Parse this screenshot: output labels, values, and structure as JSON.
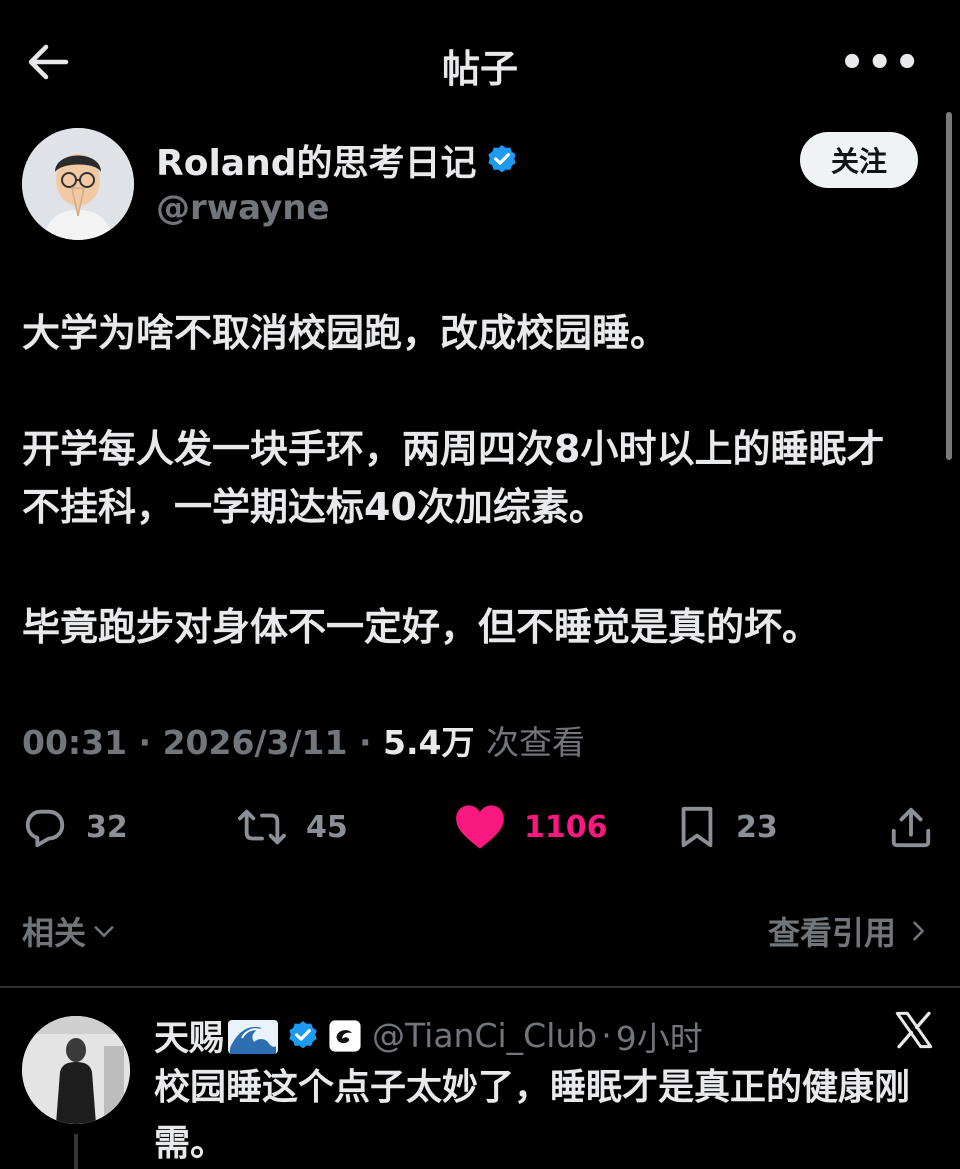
{
  "header": {
    "title": "帖子",
    "more_label": "•••"
  },
  "post": {
    "author": {
      "display_name": "Roland的思考日记",
      "handle": "@rwayne",
      "verified": true
    },
    "follow_label": "关注",
    "paragraphs": [
      "大学为啥不取消校园跑，改成校园睡。",
      "开学每人发一块手环，两周四次8小时以上的睡眠才不挂科，一学期达标40次加综素。",
      "毕竟跑步对身体不一定好，但不睡觉是真的坏。"
    ],
    "meta": {
      "time": "00:31",
      "date": "2026/3/11",
      "views": "5.4万",
      "views_label": "次查看",
      "separator": "·"
    },
    "actions": {
      "replies": "32",
      "retweets": "45",
      "likes": "1106",
      "bookmarks": "23"
    }
  },
  "related_bar": {
    "related_label": "相关",
    "view_quotes_label": "查看引用"
  },
  "reply": {
    "display_name": "天赐",
    "handle": "@TianCi_Club",
    "time": "9小时",
    "separator": "·",
    "text": "校园睡这个点子太妙了，睡眠才是真正的健康刚需。"
  },
  "colors": {
    "background": "#000000",
    "text": "#e7e9ea",
    "muted": "#71767b",
    "verified": "#1d9bf0",
    "like": "#f91880"
  },
  "icons": [
    "back-arrow-icon",
    "more-icon",
    "verified-icon",
    "reply-icon",
    "retweet-icon",
    "heart-icon",
    "bookmark-icon",
    "share-icon",
    "chevron-down-icon",
    "chevron-right-icon",
    "wave-emoji-icon",
    "affiliate-badge-icon",
    "x-logo-icon"
  ]
}
